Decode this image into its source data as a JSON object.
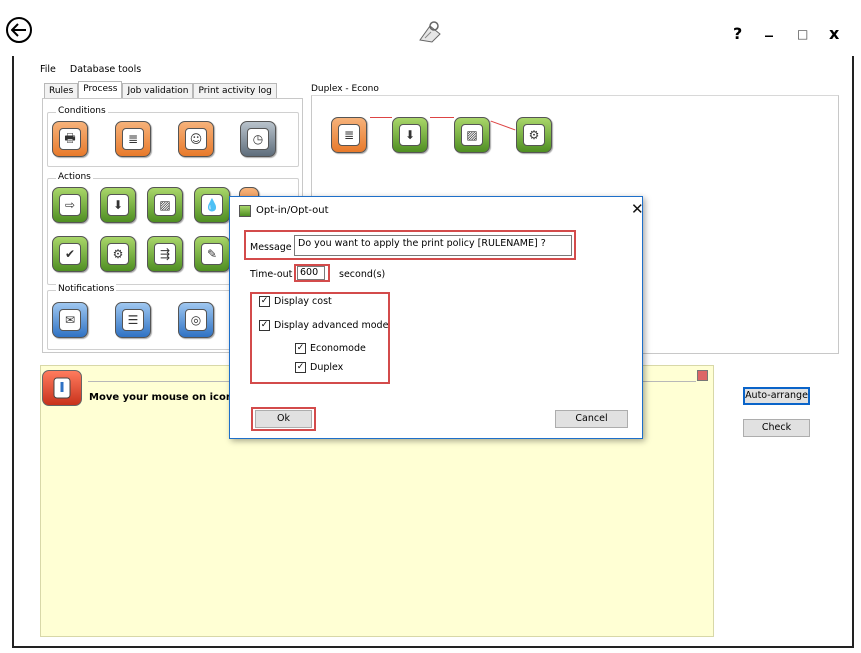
{
  "window": {
    "help_label": "?",
    "minimize_label": "_",
    "maximize_label": "□",
    "close_label": "x"
  },
  "menu": {
    "items": [
      "File",
      "Database tools"
    ]
  },
  "tabs": [
    {
      "label": "Rules",
      "active": false
    },
    {
      "label": "Process",
      "active": true
    },
    {
      "label": "Job validation",
      "active": false
    },
    {
      "label": "Print activity log",
      "active": false
    }
  ],
  "left_panel": {
    "conditions_title": "Conditions",
    "actions_title": "Actions",
    "notifications_title": "Notifications"
  },
  "right_panel": {
    "title": "Duplex - Econo"
  },
  "info": {
    "text": "Move your mouse on icons to"
  },
  "buttons": {
    "auto_arrange": "Auto-arrange",
    "check": "Check"
  },
  "dialog": {
    "title": "Opt-in/Opt-out",
    "close_label": "✕",
    "message_label": "Message",
    "message_value": "Do you want to apply the print policy [RULENAME] ?",
    "timeout_label": "Time-out",
    "timeout_value": "600",
    "timeout_unit": "second(s)",
    "display_cost": "Display cost",
    "display_advanced": "Display advanced mode",
    "economode": "Economode",
    "duplex": "Duplex",
    "ok_label": "Ok",
    "cancel_label": "Cancel"
  },
  "colors": {
    "accent_red": "#d34b4b",
    "info_bg": "#ffffd4",
    "dialog_border": "#1e6fc9"
  }
}
